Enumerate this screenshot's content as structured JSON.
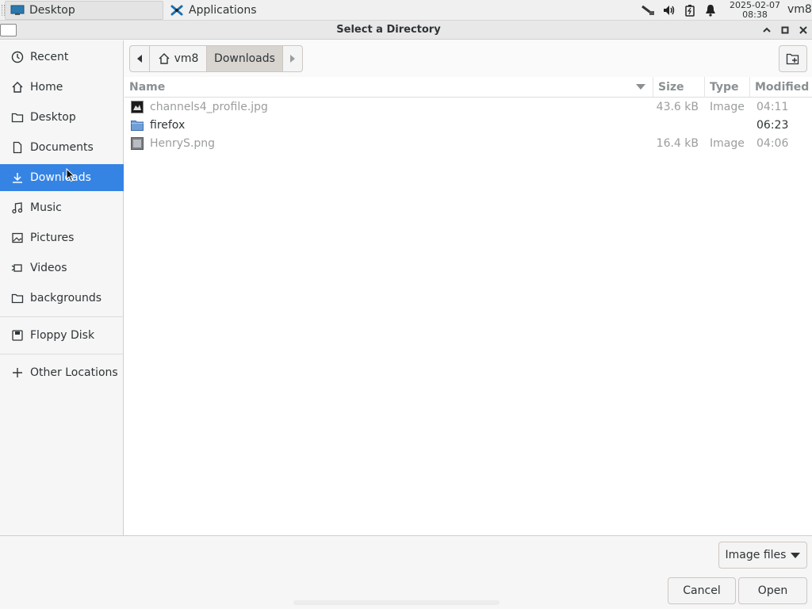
{
  "panel": {
    "tasks": [
      {
        "label": "Desktop",
        "icon": "desktop-icon"
      },
      {
        "label": "Applications",
        "icon": "applications-icon"
      }
    ],
    "tray_icons": [
      "network-icon",
      "volume-icon",
      "battery-icon",
      "notification-bell-icon"
    ],
    "clock": {
      "date": "2025-02-07",
      "time": "08:38"
    },
    "user": "vm8"
  },
  "window": {
    "title": "Select a Directory",
    "controls": [
      "minimize-icon",
      "maximize-icon",
      "close-icon"
    ]
  },
  "sidebar": {
    "items": [
      {
        "label": "Recent",
        "icon": "clock-icon"
      },
      {
        "label": "Home",
        "icon": "home-icon"
      },
      {
        "label": "Desktop",
        "icon": "folder-icon"
      },
      {
        "label": "Documents",
        "icon": "document-icon"
      },
      {
        "label": "Downloads",
        "icon": "download-icon",
        "active": true
      },
      {
        "label": "Music",
        "icon": "music-icon"
      },
      {
        "label": "Pictures",
        "icon": "picture-icon"
      },
      {
        "label": "Videos",
        "icon": "video-icon"
      },
      {
        "label": "backgrounds",
        "icon": "folder-icon"
      }
    ],
    "devices": [
      {
        "label": "Floppy Disk",
        "icon": "floppy-icon"
      }
    ],
    "other": {
      "label": "Other Locations",
      "icon": "plus-icon"
    }
  },
  "pathbar": {
    "segments": [
      "vm8",
      "Downloads"
    ]
  },
  "filelist": {
    "columns": {
      "name": "Name",
      "size": "Size",
      "type": "Type",
      "modified": "Modified"
    },
    "rows": [
      {
        "name": "channels4_profile.jpg",
        "size": "43.6 kB",
        "type": "Image",
        "modified": "04:11",
        "icon": "image-file-icon"
      },
      {
        "name": "firefox",
        "size": "",
        "type": "",
        "modified": "06:23",
        "icon": "folder-icon"
      },
      {
        "name": "HenryS.png",
        "size": "16.4 kB",
        "type": "Image",
        "modified": "04:06",
        "icon": "image-file-icon"
      }
    ]
  },
  "footer": {
    "filter_label": "Image files",
    "cancel_label": "Cancel",
    "open_label": "Open"
  },
  "colors": {
    "accent": "#3584e4",
    "folder": "#6f9fd8"
  }
}
